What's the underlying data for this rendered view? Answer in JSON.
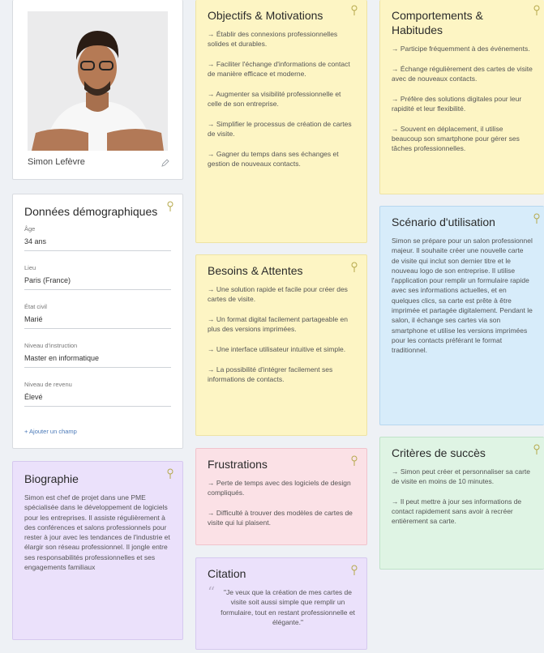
{
  "profile": {
    "name": "Simon Lefèvre"
  },
  "demographics": {
    "title": "Données démographiques",
    "fields": [
      {
        "label": "Âge",
        "value": "34 ans"
      },
      {
        "label": "Lieu",
        "value": "Paris (France)"
      },
      {
        "label": "État civil",
        "value": "Marié"
      },
      {
        "label": "Niveau d'instruction",
        "value": "Master en informatique"
      },
      {
        "label": "Niveau de revenu",
        "value": "Élevé"
      }
    ],
    "add_field": "+ Ajouter un champ"
  },
  "biography": {
    "title": "Biographie",
    "text": "Simon est chef de projet dans une PME spécialisée dans le développement de logiciels pour les entreprises. Il assiste régulièrement à des conférences et salons professionnels pour rester à jour avec les tendances de l'industrie et élargir son réseau professionnel. Il jongle entre ses responsabilités professionnelles et ses engagements familiaux"
  },
  "goals": {
    "title": "Objectifs & Motivations",
    "items": [
      "→ Établir des connexions professionnelles solides et durables.",
      "→ Faciliter l'échange d'informations de contact de manière efficace et moderne.",
      "→ Augmenter sa visibilité professionnelle et celle de son entreprise.",
      "→ Simplifier le processus de création de cartes de visite.",
      "→ Gagner du temps dans ses échanges et gestion de nouveaux contacts."
    ]
  },
  "needs": {
    "title": "Besoins & Attentes",
    "items": [
      "→ Une solution rapide et facile pour créer des cartes de visite.",
      "→ Un format digital facilement partageable en plus des versions imprimées.",
      "→ Une interface utilisateur intuitive et simple.",
      "→ La possibilité d'intégrer facilement ses informations de contacts."
    ]
  },
  "frustrations": {
    "title": "Frustrations",
    "items": [
      "→ Perte de temps avec des logiciels de design compliqués.",
      "→ Difficulté à trouver des modèles de cartes de visite qui lui plaisent."
    ]
  },
  "quote": {
    "title": "Citation",
    "mark": "“",
    "text": "\"Je veux que la création de mes cartes de visite soit aussi simple que remplir un formulaire, tout en restant professionnelle et élégante.\""
  },
  "behaviors": {
    "title": "Comportements & Habitudes",
    "items": [
      "→ Participe fréquemment à des événements.",
      "→ Échange régulièrement des cartes de visite avec de nouveaux contacts.",
      "→ Préfère des solutions digitales pour leur rapidité et leur flexibilité.",
      "→ Souvent en déplacement, il utilise beaucoup son smartphone pour gérer ses tâches professionnelles."
    ]
  },
  "scenario": {
    "title": "Scénario d'utilisation",
    "text": "Simon se prépare pour un salon professionnel majeur. Il souhaite créer une nouvelle carte de visite qui inclut son dernier titre et le nouveau logo de son entreprise. Il utilise l'application pour remplir un formulaire rapide avec ses informations actuelles, et en quelques clics, sa carte est prête à être imprimée et partagée digitalement. Pendant le salon, il échange ses cartes via son smartphone et utilise les versions imprimées pour les contacts préférant le format traditionnel."
  },
  "success": {
    "title": "Critères de succès",
    "items": [
      "→ Simon peut créer et personnaliser sa carte de visite en moins de 10 minutes.",
      "→ Il peut mettre à jour ses informations de contact rapidement sans avoir à recréer entièrement sa carte."
    ]
  },
  "icons": {
    "pin": "pin-icon",
    "edit": "pencil-icon",
    "avatar": "avatar-photo"
  },
  "colors": {
    "yellow": "#fdf5c4",
    "blue": "#d7ecfa",
    "green": "#dff4e4",
    "pink": "#fbe1e6",
    "purple": "#ebe1fb",
    "white": "#ffffff"
  }
}
